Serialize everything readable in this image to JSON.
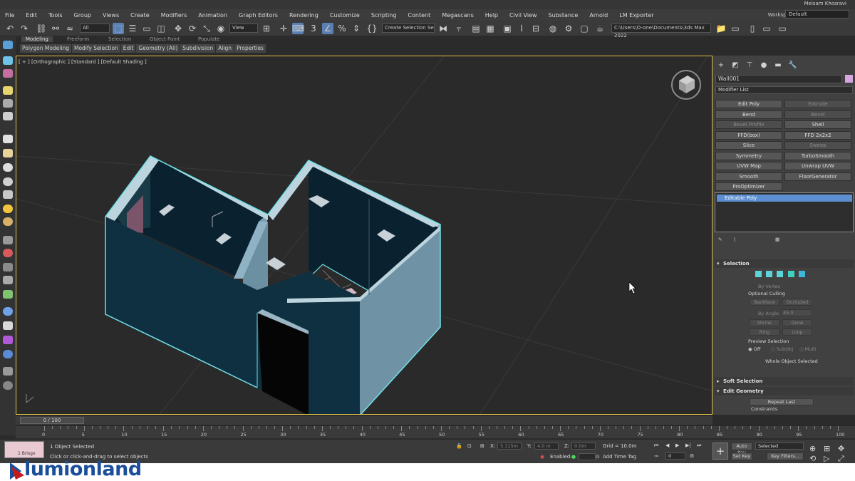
{
  "user_name": "Meisam Khosravi",
  "menu": [
    "File",
    "Edit",
    "Tools",
    "Group",
    "Views",
    "Create",
    "Modifiers",
    "Animation",
    "Graph Editors",
    "Rendering",
    "Customize",
    "Scripting",
    "Content",
    "Megascans",
    "Help",
    "Civil View",
    "Substance",
    "Arnold",
    "LM Exporter"
  ],
  "workspaces_label": "Workspaces:",
  "workspace_value": "Default",
  "toolbar": {
    "filter_value": "All",
    "view_value": "View",
    "selection_set": "Create Selection Se",
    "project_path": "C:\\Users\\O-one\\Documents\\3ds Max 2022"
  },
  "ribbon": {
    "tabs": [
      "Modeling",
      "Freeform",
      "Selection",
      "Object Paint",
      "Populate"
    ],
    "subtabs": [
      "Polygon Modeling",
      "Modify Selection",
      "Edit",
      "Geometry (All)",
      "Subdivision",
      "Align",
      "Properties"
    ]
  },
  "viewport": {
    "label": "[ + ] [Orthographic ] [Standard ] [Default Shading ]"
  },
  "panel": {
    "object_name": "Wall001",
    "object_color": "#d6a6e0",
    "modifier_list": "Modifier List",
    "buttons": [
      {
        "label": "Edit Poly",
        "enabled": true
      },
      {
        "label": "Extrude",
        "enabled": false
      },
      {
        "label": "Bend",
        "enabled": true
      },
      {
        "label": "Bevel",
        "enabled": false
      },
      {
        "label": "Bevel Profile",
        "enabled": false
      },
      {
        "label": "Shell",
        "enabled": true
      },
      {
        "label": "FFD(box)",
        "enabled": true
      },
      {
        "label": "FFD 2x2x2",
        "enabled": true
      },
      {
        "label": "Slice",
        "enabled": true
      },
      {
        "label": "Sweep",
        "enabled": false
      },
      {
        "label": "Symmetry",
        "enabled": true
      },
      {
        "label": "TurboSmooth",
        "enabled": true
      },
      {
        "label": "UVW Map",
        "enabled": true
      },
      {
        "label": "Unwrap UVW",
        "enabled": true
      },
      {
        "label": "Smooth",
        "enabled": true
      },
      {
        "label": "FloorGenerator",
        "enabled": true
      },
      {
        "label": "ProOptimizer",
        "enabled": true
      }
    ],
    "stack_item": "Editable Poly",
    "selection_title": "Selection",
    "by_vertex": "By Vertex",
    "optional_culling": "Optional Culling",
    "backface": "Backface",
    "occluded": "Occluded",
    "by_angle": "By Angle:",
    "angle_value": "45.0",
    "shrink": "Shrink",
    "grow": "Grow",
    "ring": "Ring",
    "loop": "Loop",
    "preview_selection": "Preview Selection",
    "off": "Off",
    "subobj": "SubObj",
    "multi": "Multi",
    "whole_object": "Whole Object Selected",
    "soft_selection": "Soft Selection",
    "edit_geometry": "Edit Geometry",
    "repeat_last": "Repeat Last",
    "constraints": "Constraints"
  },
  "timeline": {
    "frame": "0 / 100",
    "ticks": [
      "0",
      "5",
      "10",
      "15",
      "20",
      "25",
      "30",
      "35",
      "40",
      "45",
      "50",
      "55",
      "60",
      "65",
      "70",
      "75",
      "80",
      "85",
      "90",
      "95",
      "100"
    ]
  },
  "status": {
    "maxscript": "1 Brisgo",
    "objects_selected": "1 Object Selected",
    "prompt": "Click or click-and-drag to select objects",
    "x_label": "X:",
    "x_value": "5.115m",
    "y_label": "Y:",
    "y_value": "4.0 m",
    "z_label": "Z:",
    "z_value": "0.0m",
    "grid": "Grid = 10.0m",
    "enabled_label": "Enabled:",
    "add_time_tag": "Add Time Tag",
    "auto_key": "Auto Key",
    "set_key": "Set Key",
    "selected": "Selected",
    "key_filters": "Key Filters...",
    "frame_value": "0"
  },
  "watermark": "lumionland"
}
